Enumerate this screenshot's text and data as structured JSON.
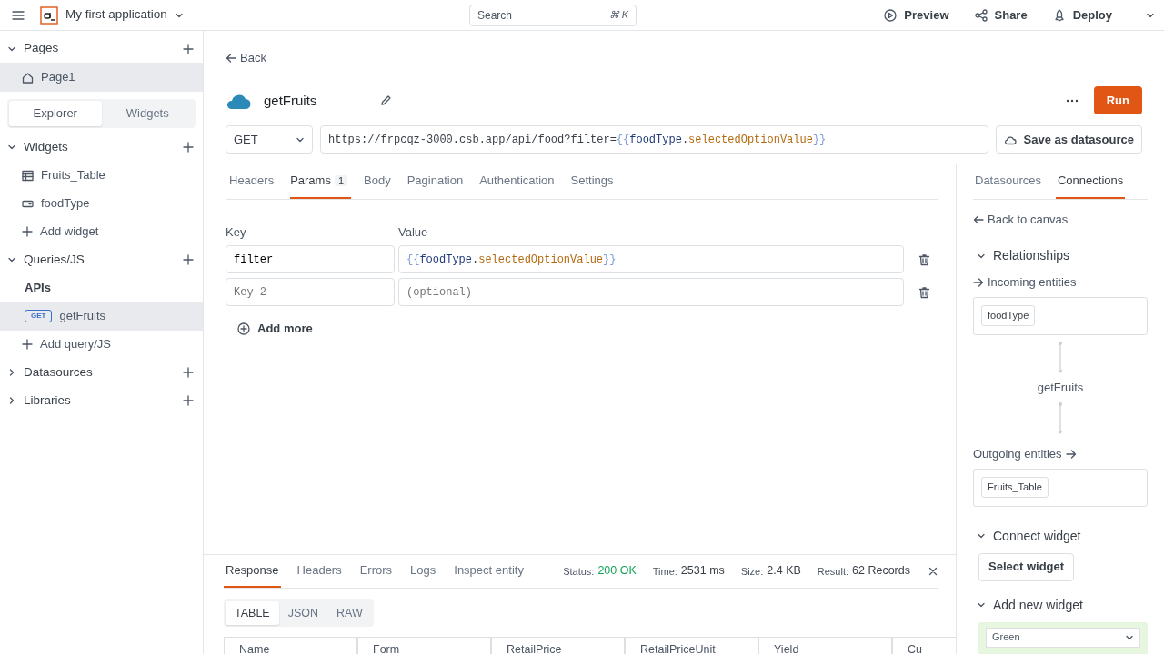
{
  "header": {
    "app_name": "My first application",
    "search": {
      "placeholder": "Search",
      "shortcut": "⌘ K"
    },
    "actions": [
      {
        "kind": "preview",
        "label": "Preview"
      },
      {
        "kind": "share",
        "label": "Share"
      },
      {
        "kind": "deploy",
        "label": "Deploy"
      }
    ]
  },
  "sidebar": {
    "sections": [
      {
        "label": "Pages",
        "expanded": true,
        "items": [
          {
            "kind": "page",
            "label": "Page1",
            "selected": true
          }
        ]
      },
      {
        "kind": "view_tabs",
        "tabs": [
          {
            "label": "Explorer",
            "selected": true
          },
          {
            "label": "Widgets",
            "selected": false
          }
        ]
      },
      {
        "label": "Widgets",
        "expanded": true,
        "items": [
          {
            "kind": "table",
            "label": "Fruits_Table",
            "selected": false
          },
          {
            "kind": "input",
            "label": "foodType",
            "selected": false
          },
          {
            "kind": "add",
            "label": "Add widget",
            "selected": false
          }
        ]
      },
      {
        "label": "Queries/JS",
        "expanded": true,
        "items": [
          {
            "kind": "group",
            "label": "APIs",
            "selected": false
          },
          {
            "kind": "api",
            "method": "GET",
            "label": "getFruits",
            "selected": true
          },
          {
            "kind": "add",
            "label": "Add query/JS",
            "selected": false
          }
        ]
      },
      {
        "label": "Datasources",
        "expanded": false
      },
      {
        "label": "Libraries",
        "expanded": false
      }
    ]
  },
  "editor": {
    "back": "Back",
    "name": "getFruits",
    "run": "Run",
    "save_datasource": "Save as datasource",
    "method": "GET",
    "url": [
      {
        "kind": "plain",
        "text": "https://frpcqz-3000.csb.app/api/food?filter="
      },
      {
        "kind": "brace",
        "text": "{{"
      },
      {
        "kind": "ident",
        "text": "foodType"
      },
      {
        "kind": "plain",
        "text": "."
      },
      {
        "kind": "prop",
        "text": "selectedOptionValue"
      },
      {
        "kind": "brace",
        "text": "}}"
      }
    ],
    "tabs": [
      {
        "label": "Headers",
        "selected": false
      },
      {
        "label": "Params",
        "count": "1",
        "selected": true
      },
      {
        "label": "Body",
        "selected": false
      },
      {
        "label": "Pagination",
        "selected": false
      },
      {
        "label": "Authentication",
        "selected": false
      },
      {
        "label": "Settings",
        "selected": false
      }
    ],
    "params": {
      "key_heading": "Key",
      "value_heading": "Value",
      "rows": [
        {
          "key": "filter",
          "value": [
            {
              "kind": "brace",
              "text": "{{"
            },
            {
              "kind": "ident",
              "text": "foodType"
            },
            {
              "kind": "plain",
              "text": "."
            },
            {
              "kind": "prop",
              "text": "selectedOptionValue"
            },
            {
              "kind": "brace",
              "text": "}}"
            }
          ]
        },
        {
          "key_placeholder": "Key 2",
          "value_placeholder": "(optional)"
        }
      ],
      "add_more": "Add more"
    }
  },
  "response": {
    "tabs": [
      {
        "label": "Response",
        "selected": true
      },
      {
        "label": "Headers",
        "selected": false
      },
      {
        "label": "Errors",
        "selected": false
      },
      {
        "label": "Logs",
        "selected": false
      },
      {
        "label": "Inspect entity",
        "selected": false
      }
    ],
    "stats": [
      {
        "label": "Status:",
        "value": "200 OK",
        "kind": "success"
      },
      {
        "label": "Time:",
        "value": "2531 ms",
        "kind": "plain"
      },
      {
        "label": "Size:",
        "value": "2.4 KB",
        "kind": "plain"
      },
      {
        "label": "Result:",
        "value": "62 Records",
        "kind": "plain"
      }
    ],
    "views": [
      {
        "label": "TABLE",
        "selected": true
      },
      {
        "label": "JSON",
        "selected": false
      },
      {
        "label": "RAW",
        "selected": false
      }
    ],
    "table": {
      "columns": [
        "Name",
        "Form",
        "RetailPrice",
        "RetailPriceUnit",
        "Yield",
        "Cu"
      ]
    }
  },
  "right_panel": {
    "tabs": [
      {
        "label": "Datasources",
        "selected": false
      },
      {
        "label": "Connections",
        "selected": true
      }
    ],
    "back": "Back to canvas",
    "relationships": {
      "title": "Relationships",
      "expanded": true,
      "incoming_title": "Incoming entities",
      "incoming": [
        "foodType"
      ],
      "center": "getFruits",
      "outgoing_title": "Outgoing entities",
      "outgoing": [
        "Fruits_Table"
      ]
    },
    "connect": {
      "title": "Connect widget",
      "expanded": true,
      "button": "Select widget"
    },
    "add_widget": {
      "title": "Add new widget",
      "expanded": true,
      "preview_value": "Green"
    }
  }
}
